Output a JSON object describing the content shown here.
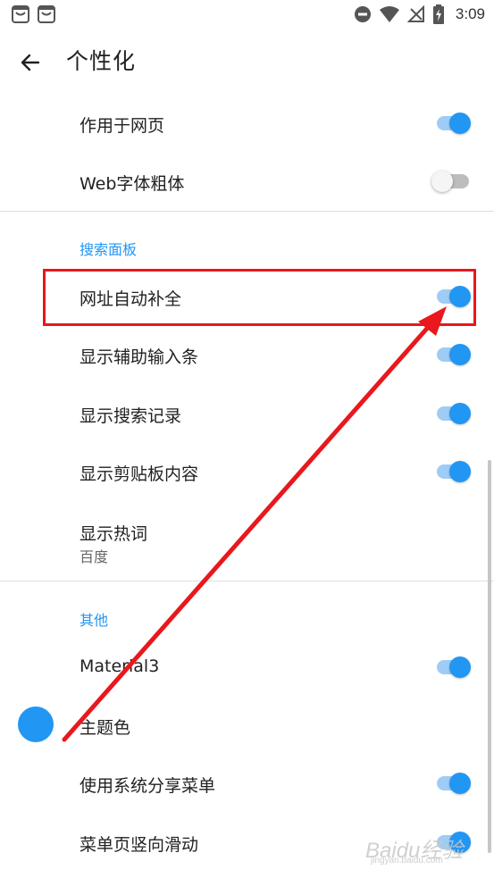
{
  "status_bar": {
    "time": "3:09",
    "notification_icons": [
      "app-notification-icon",
      "app-notification-icon"
    ],
    "system_icons": [
      "do-not-disturb-icon",
      "wifi-icon",
      "no-signal-icon",
      "battery-charging-icon"
    ]
  },
  "app_bar": {
    "title": "个性化",
    "back_icon": "arrow-back-icon"
  },
  "settings": {
    "apply_to_web": {
      "label": "作用于网页",
      "enabled": true
    },
    "web_font_bold": {
      "label": "Web字体粗体",
      "enabled": false
    },
    "search_panel": {
      "header": "搜索面板",
      "url_autocomplete": {
        "label": "网址自动补全",
        "enabled": true
      },
      "show_input_assist_bar": {
        "label": "显示辅助输入条",
        "enabled": true
      },
      "show_search_history": {
        "label": "显示搜索记录",
        "enabled": true
      },
      "show_clipboard": {
        "label": "显示剪贴板内容",
        "enabled": true
      },
      "show_hot_words": {
        "label": "显示热词",
        "value": "百度"
      }
    },
    "other": {
      "header": "其他",
      "material3": {
        "label": "Material3",
        "enabled": true
      },
      "theme_color": {
        "label": "主题色",
        "color": "#2196f3"
      },
      "system_share_menu": {
        "label": "使用系统分享菜单",
        "enabled": true
      },
      "menu_vertical_scroll": {
        "label": "菜单页竖向滑动",
        "enabled": true
      }
    }
  },
  "watermark": {
    "text": "Baidu经验",
    "sub": "jingyan.baidu.com"
  },
  "colors": {
    "accent": "#2196f3",
    "accent_track": "#9fccf5",
    "annotation_red": "#e8181c",
    "divider": "#e0e0e0"
  }
}
